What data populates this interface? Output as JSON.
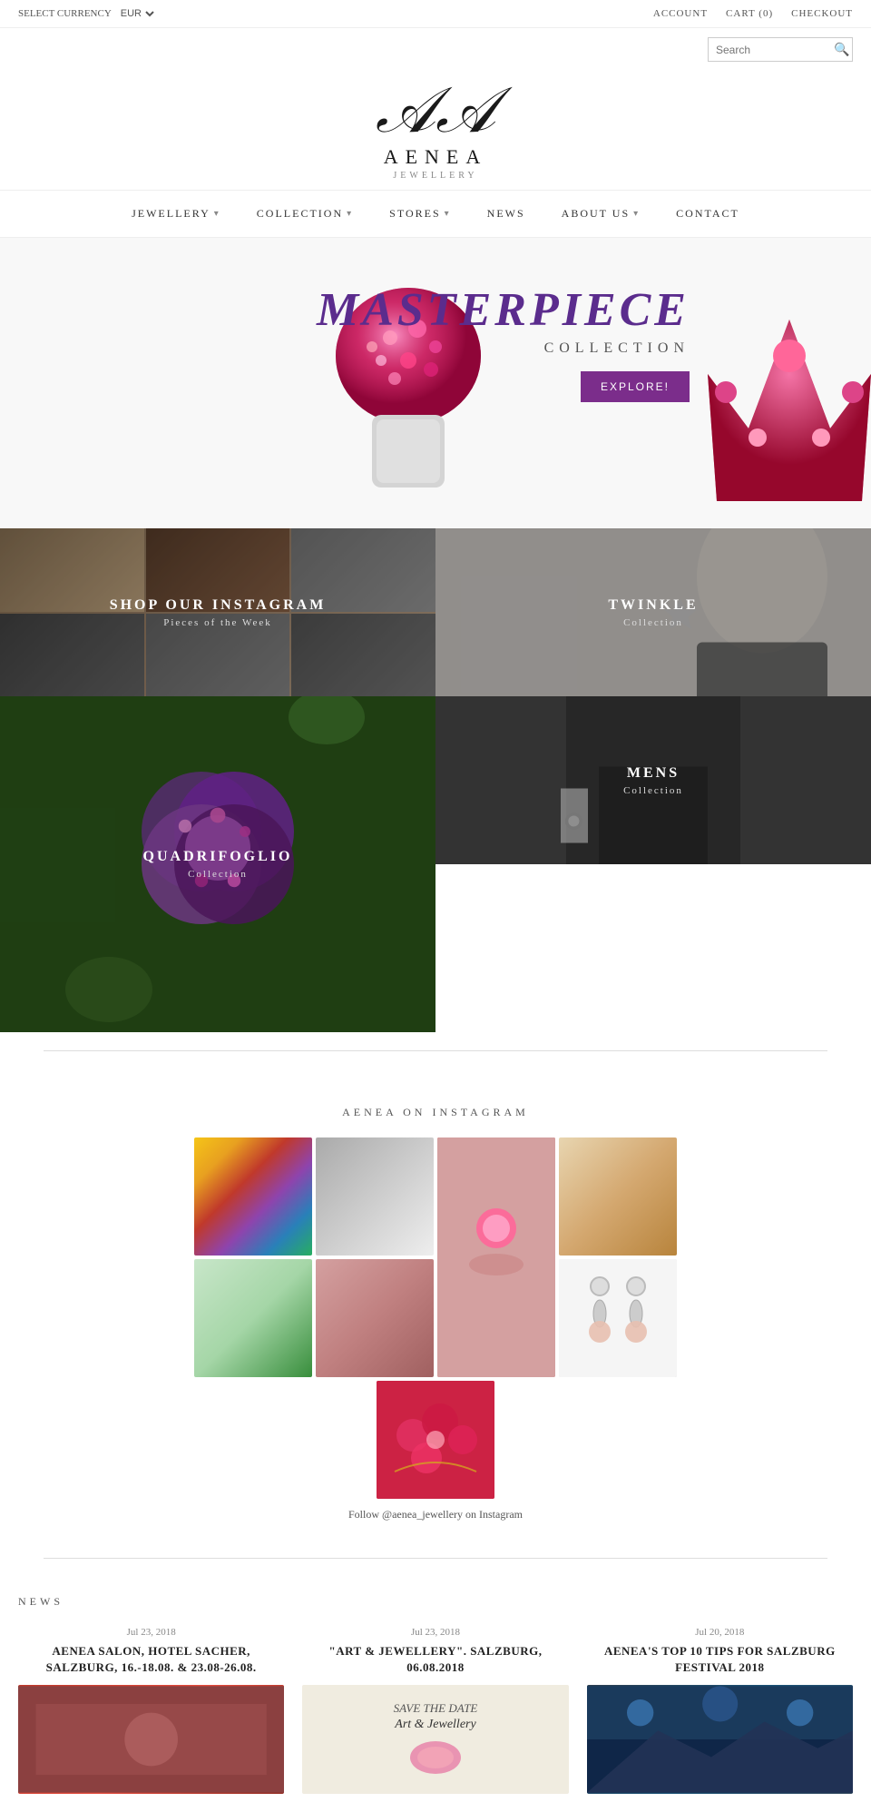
{
  "topbar": {
    "currency_label": "SELECT CURRENCY",
    "currency_value": "EUR",
    "account_label": "ACCOUNT",
    "cart_label": "CART (0)",
    "checkout_label": "CHECKOUT"
  },
  "search": {
    "placeholder": "Search"
  },
  "logo": {
    "symbol": "𝒜",
    "brand": "AENEA",
    "tagline": "JEWELLERY"
  },
  "nav": {
    "items": [
      {
        "label": "JEWELLERY",
        "has_dropdown": true
      },
      {
        "label": "COLLECTION",
        "has_dropdown": true
      },
      {
        "label": "STORES",
        "has_dropdown": true
      },
      {
        "label": "NEWS",
        "has_dropdown": false
      },
      {
        "label": "ABOUT US",
        "has_dropdown": true
      },
      {
        "label": "CONTACT",
        "has_dropdown": false
      }
    ]
  },
  "hero": {
    "title": "MASTERPIECE",
    "subtitle": "COLLECTION",
    "button_label": "EXPLORE!"
  },
  "grid": {
    "items": [
      {
        "title": "SHOP OUR INSTAGRAM",
        "subtitle": "Pieces of the Week",
        "size": "normal"
      },
      {
        "title": "TWINKLE",
        "subtitle": "Collection",
        "size": "normal"
      },
      {
        "title": "QUADRIFOGLIO",
        "subtitle": "Collection",
        "size": "tall"
      },
      {
        "title": "MENS",
        "subtitle": "Collection",
        "size": "normal"
      }
    ]
  },
  "instagram": {
    "section_title": "AENEA ON INSTAGRAM",
    "follow_text": "Follow",
    "handle": "@aenea_jewellery",
    "on_text": "on Instagram"
  },
  "news": {
    "section_title": "NEWS",
    "items": [
      {
        "date": "Jul 23, 2018",
        "headline": "AENEA SALON, HOTEL SACHER, SALZBURG, 16.-18.08. & 23.08-26.08."
      },
      {
        "date": "Jul 23, 2018",
        "headline": "\"ART & JEWELLERY\". SALZBURG, 06.08.2018"
      },
      {
        "date": "Jul 20, 2018",
        "headline": "AENEA'S TOP 10 TIPS FOR SALZBURG FESTIVAL 2018"
      }
    ]
  }
}
